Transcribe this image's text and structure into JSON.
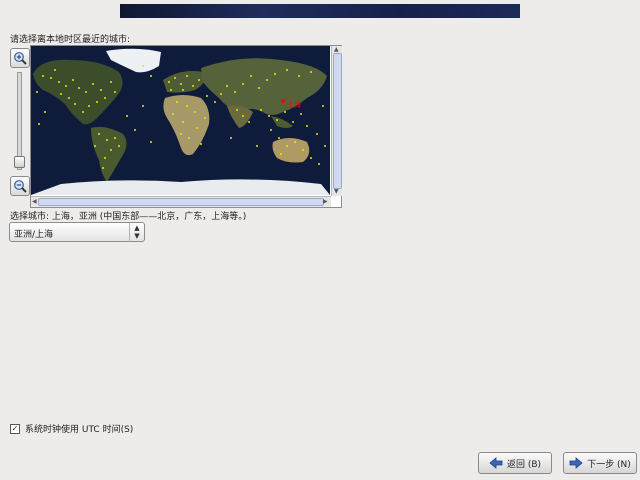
{
  "header": {
    "banner": "top-banner"
  },
  "timezone": {
    "prompt": "请选择离本地时区最近的城市:",
    "map_city_label": "上海",
    "selected_label": "选择城市: 上海，亚洲 (中国东部——北京，广东，上海等。)",
    "select_value": "亚洲/上海"
  },
  "options": {
    "utc_label": "系统时钟使用 UTC 时间(S)",
    "utc_checked": true
  },
  "buttons": {
    "back_label": "返回 (B)",
    "next_label": "下一步 (N)"
  },
  "icons": {
    "zoom_in": "zoom-in-icon",
    "zoom_out": "zoom-out-icon",
    "back": "arrow-left-icon",
    "next": "arrow-right-icon"
  },
  "colors": {
    "city_dot": "#e8e800",
    "selected_city": "#dd1111",
    "ocean": "#0f1b3b"
  }
}
